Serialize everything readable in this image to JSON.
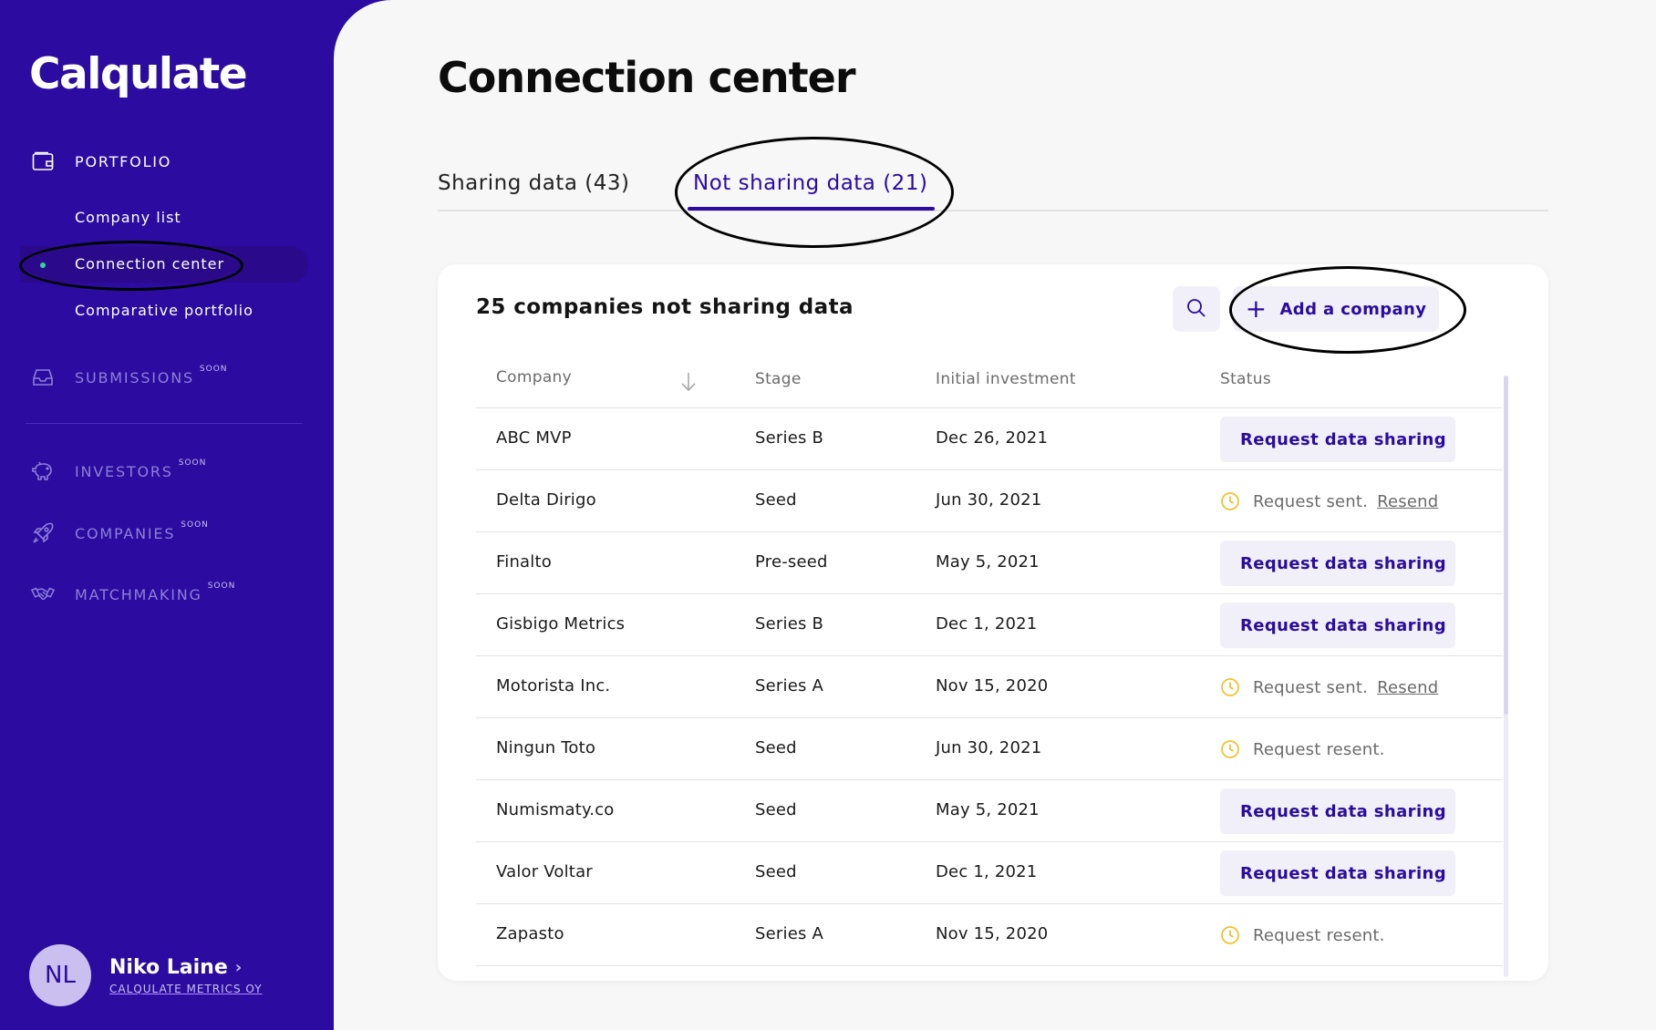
{
  "sidebar": {
    "logo": "Calqulate",
    "portfolio": {
      "label": "PORTFOLIO",
      "items": [
        {
          "label": "Company list"
        },
        {
          "label": "Connection center"
        },
        {
          "label": "Comparative portfolio"
        }
      ]
    },
    "sections": [
      {
        "label": "SUBMISSIONS",
        "badge": "SOON",
        "icon": "inbox-icon"
      },
      {
        "label": "INVESTORS",
        "badge": "SOON",
        "icon": "piggy-bank-icon"
      },
      {
        "label": "COMPANIES",
        "badge": "SOON",
        "icon": "rocket-icon"
      },
      {
        "label": "MATCHMAKING",
        "badge": "SOON",
        "icon": "handshake-icon"
      }
    ],
    "user": {
      "initials": "NL",
      "name": "Niko Laine",
      "org": "CALQULATE METRICS OY"
    }
  },
  "main": {
    "title": "Connection center",
    "tabs": [
      {
        "label": "Sharing data (43)"
      },
      {
        "label": "Not sharing data (21)"
      }
    ],
    "card": {
      "title": "25 companies not sharing data",
      "add_label": "Add a company",
      "columns": [
        "Company",
        "Stage",
        "Initial investment",
        "Status"
      ],
      "rows": [
        {
          "company": "ABC MVP",
          "stage": "Series B",
          "investment": "Dec 26, 2021",
          "status": "Request data sharing"
        },
        {
          "company": "Delta Dirigo",
          "stage": "Seed",
          "investment": "Jun 30, 2021",
          "status": "Request sent.",
          "action": "Resend"
        },
        {
          "company": "Finalto",
          "stage": "Pre-seed",
          "investment": "May 5, 2021",
          "status": "Request data sharing"
        },
        {
          "company": "Gisbigo Metrics",
          "stage": "Series B",
          "investment": "Dec 1, 2021",
          "status": "Request data sharing"
        },
        {
          "company": "Motorista Inc.",
          "stage": "Series A",
          "investment": "Nov 15, 2020",
          "status": "Request sent.",
          "action": "Resend"
        },
        {
          "company": "Ningun Toto",
          "stage": "Seed",
          "investment": "Jun 30, 2021",
          "status": "Request resent."
        },
        {
          "company": "Numismaty.co",
          "stage": "Seed",
          "investment": "May 5, 2021",
          "status": "Request data sharing"
        },
        {
          "company": "Valor Voltar",
          "stage": "Seed",
          "investment": "Dec 1, 2021",
          "status": "Request data sharing"
        },
        {
          "company": "Zapasto",
          "stage": "Series A",
          "investment": "Nov 15, 2020",
          "status": "Request resent."
        }
      ]
    }
  },
  "colors": {
    "brand": "#2b0ba0",
    "accent_dot": "#36d39e",
    "pending": "#f2c230"
  }
}
